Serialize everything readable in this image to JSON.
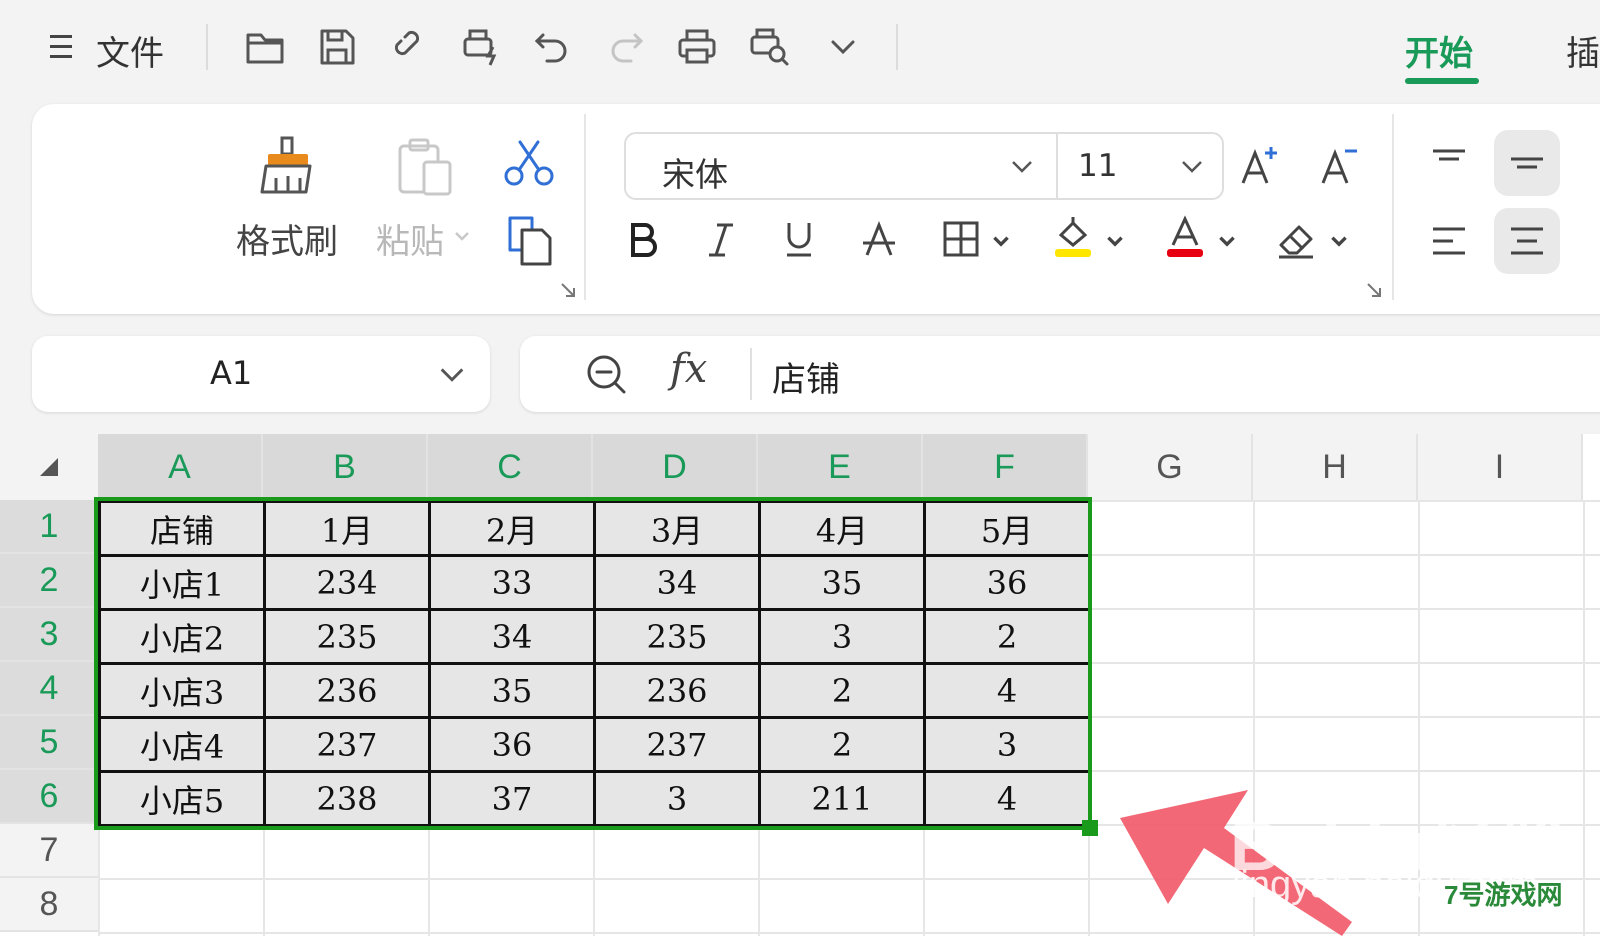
{
  "toolbar": {
    "menu_icon_glyph": "☰",
    "file_label": "文件",
    "tab_start": "开始",
    "tab_insert": "插"
  },
  "ribbon": {
    "format_painter_label": "格式刷",
    "paste_label": "粘贴",
    "font_name": "宋体",
    "font_size": "11",
    "highlight_color": "#ffe600",
    "font_color": "#e60012"
  },
  "namebox": {
    "cell_ref": "A1"
  },
  "formula_bar": {
    "fx_label": "fx",
    "content": "店铺"
  },
  "grid": {
    "columns": [
      "A",
      "B",
      "C",
      "D",
      "E",
      "F",
      "G",
      "H",
      "I"
    ],
    "rows": [
      "1",
      "2",
      "3",
      "4",
      "5",
      "6",
      "7",
      "8"
    ],
    "cells": [
      [
        "店铺",
        "1月",
        "2月",
        "3月",
        "4月",
        "5月"
      ],
      [
        "小店1",
        "234",
        "33",
        "34",
        "35",
        "36"
      ],
      [
        "小店2",
        "235",
        "34",
        "235",
        "3",
        "2"
      ],
      [
        "小店3",
        "236",
        "35",
        "236",
        "2",
        "4"
      ],
      [
        "小店4",
        "237",
        "36",
        "237",
        "2",
        "3"
      ],
      [
        "小店5",
        "238",
        "37",
        "3",
        "211",
        "4"
      ]
    ],
    "selection_color": "#1a9a1a",
    "accent_color": "#1a9a58"
  },
  "watermark": {
    "brand": "Baidu经验",
    "url": "jingyan.baidu.com",
    "badge": "7号游戏网"
  }
}
